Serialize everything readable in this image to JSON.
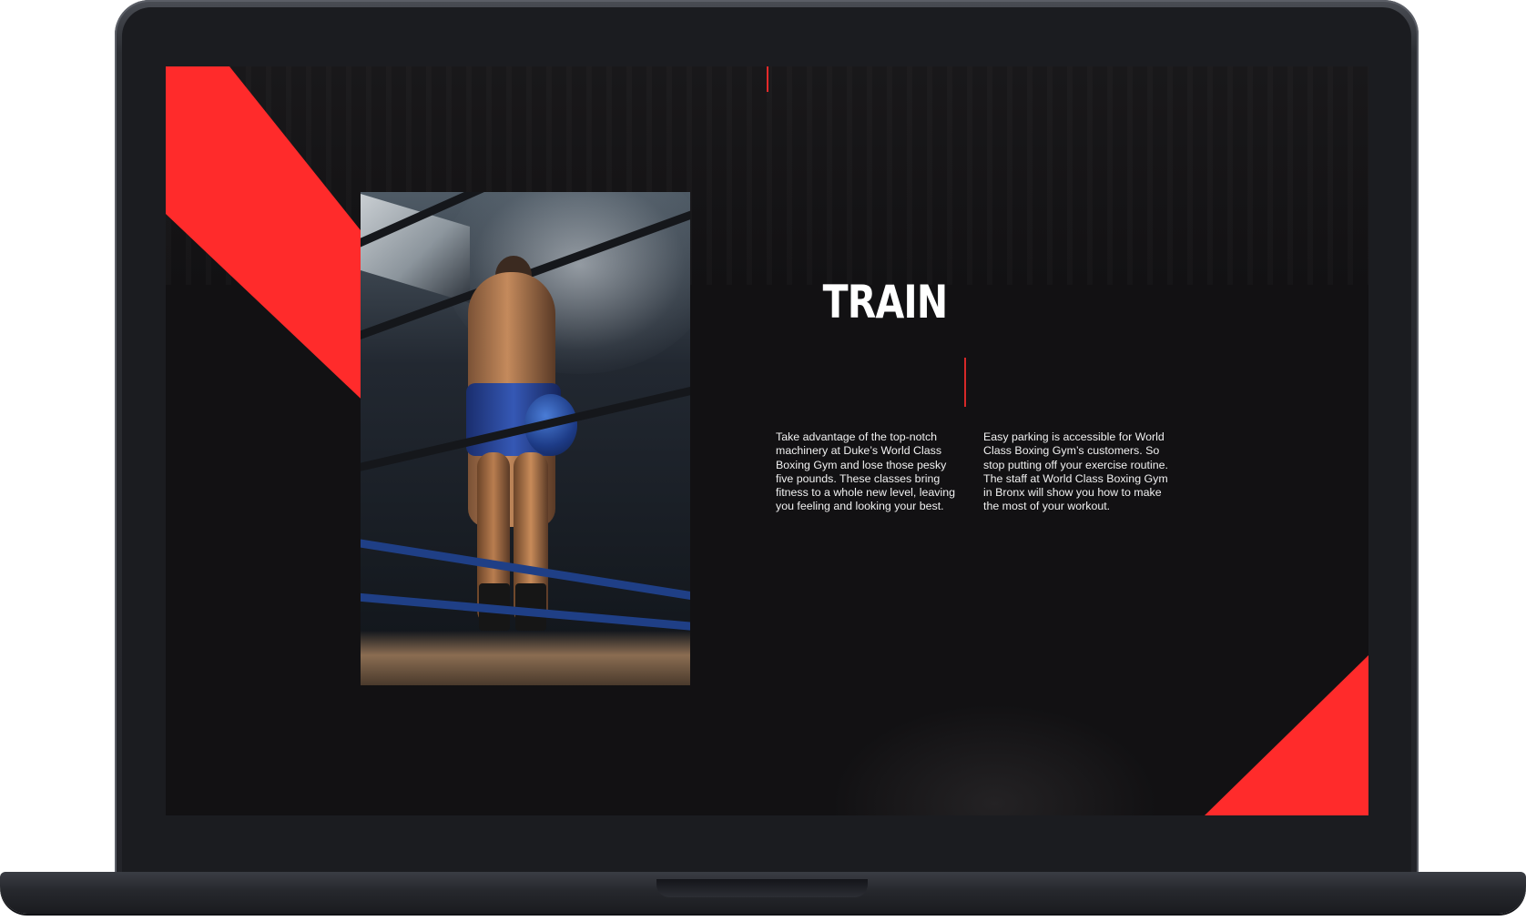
{
  "page": {
    "heading": "TRAIN",
    "columns": [
      "Take advantage of the top-notch machinery at Duke’s World Class Boxing Gym and lose those pesky five pounds. These classes bring fitness to a whole new level, leaving you feeling and looking your best.",
      "Easy parking is accessible for World Class Boxing Gym’s customers. So stop putting off your exercise routine. The staff at World Class Boxing Gym in Bronx will show you how to make the most of your workout."
    ]
  },
  "colors": {
    "accent": "#ff2b2b",
    "background": "#121113",
    "text": "#ffffff"
  }
}
